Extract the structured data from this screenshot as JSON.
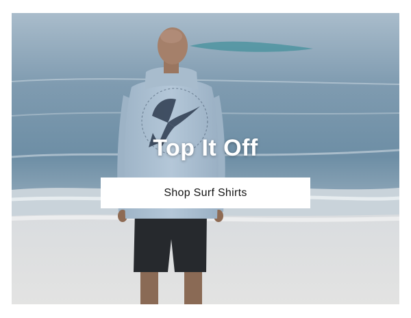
{
  "hero": {
    "title": "Top It Off",
    "image_description": "Man in a light blue hooded surf shirt standing on a beach facing the ocean",
    "cta_label": "Shop Surf Shirts"
  },
  "colors": {
    "button_bg": "#ffffff",
    "button_text": "#111111",
    "title_text": "#ffffff"
  }
}
